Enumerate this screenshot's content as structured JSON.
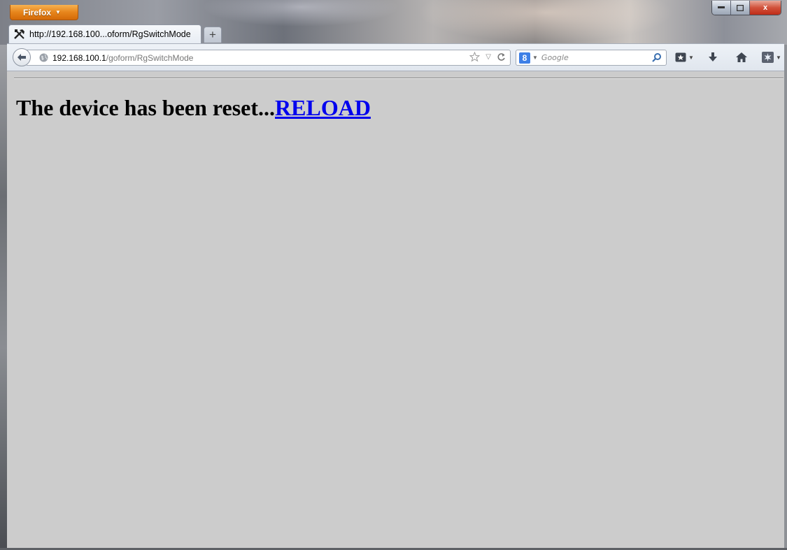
{
  "app_button": {
    "label": "Firefox"
  },
  "window_controls": {
    "minimize": "–",
    "maximize": "□",
    "close": "x"
  },
  "tab": {
    "title": "http://192.168.100...oform/RgSwitchMode",
    "new_tab": "+"
  },
  "address_bar": {
    "host": "192.168.100.1",
    "path": "/goform/RgSwitchMode"
  },
  "search_bar": {
    "engine": "Google",
    "placeholder": "Google"
  },
  "toolbar_icons": [
    "back-icon",
    "globe-icon",
    "bookmark-star-icon",
    "dropdown-icon",
    "reload-icon",
    "search-icon",
    "bookmarks-icon",
    "download-icon",
    "home-icon",
    "addon-icon"
  ],
  "page": {
    "message": "The device has been reset...",
    "link_text": "RELOAD"
  },
  "colors": {
    "content_bg": "#cccccc",
    "link": "#0000ee",
    "app_button": "#e7851c"
  }
}
